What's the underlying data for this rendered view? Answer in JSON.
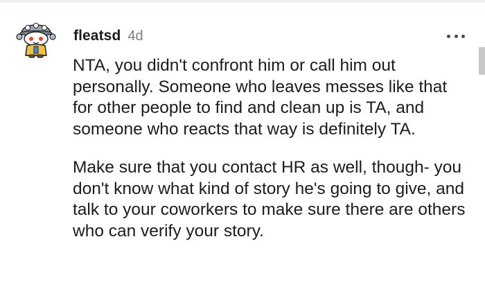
{
  "comment": {
    "author": "fleatsd",
    "age": "4d",
    "paragraphs": [
      "NTA, you didn't confront him or call him out personally. Someone who leaves messes like that for other people to find and clean up is TA, and someone who reacts that way is definitely TA.",
      "Make sure that you contact HR as well, though- you don't know what kind of story he's going to give, and talk to your coworkers to make sure there are others who can verify your story."
    ]
  },
  "icons": {
    "avatar": "snoo-avatar-icon",
    "more": "more-options-icon"
  },
  "colors": {
    "text": "#1c1c1c",
    "muted": "#7c7c7c",
    "avatar_shirt": "#f0c24a",
    "avatar_face": "#ffffff",
    "scrollbar": "#c8c8c8"
  }
}
